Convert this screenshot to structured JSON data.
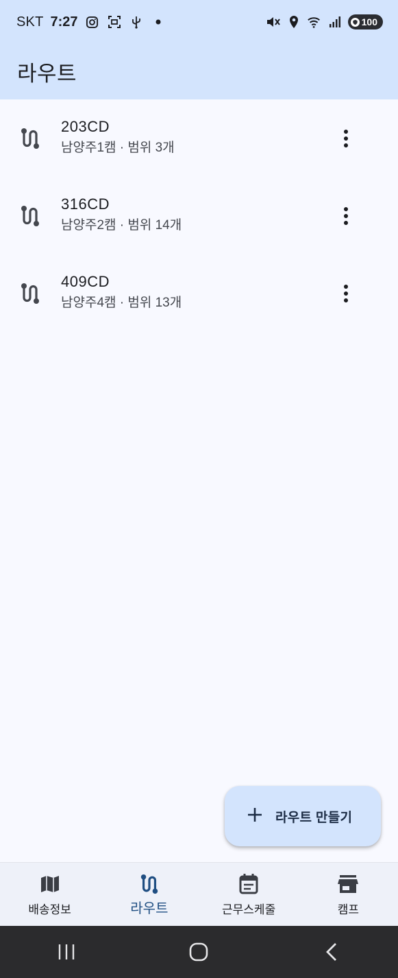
{
  "status_bar": {
    "carrier": "SKT",
    "time": "7:27",
    "battery": "100",
    "icons": [
      "instagram-icon",
      "screenshot-icon",
      "usb-icon",
      "dot-icon",
      "mute-icon",
      "location-icon",
      "wifi-icon",
      "signal-icon",
      "battery-icon"
    ]
  },
  "app_bar": {
    "title": "라우트"
  },
  "routes": [
    {
      "title": "203CD",
      "subtitle": "남양주1캠 · 범위 3개"
    },
    {
      "title": "316CD",
      "subtitle": "남양주2캠 · 범위 14개"
    },
    {
      "title": "409CD",
      "subtitle": "남양주4캠 · 범위 13개"
    }
  ],
  "fab": {
    "label": "라우트 만들기",
    "icon": "plus-icon"
  },
  "bottom_nav": {
    "items": [
      {
        "label": "배송정보",
        "icon": "map-icon",
        "active": false
      },
      {
        "label": "라우트",
        "icon": "route-icon",
        "active": true
      },
      {
        "label": "근무스케줄",
        "icon": "calendar-icon",
        "active": false
      },
      {
        "label": "캠프",
        "icon": "store-icon",
        "active": false
      }
    ]
  },
  "colors": {
    "app_bar_bg": "#d3e4fd",
    "background": "#f8f9ff",
    "active_nav": "#1f4e82",
    "system_nav_bg": "#2b2b2d"
  }
}
